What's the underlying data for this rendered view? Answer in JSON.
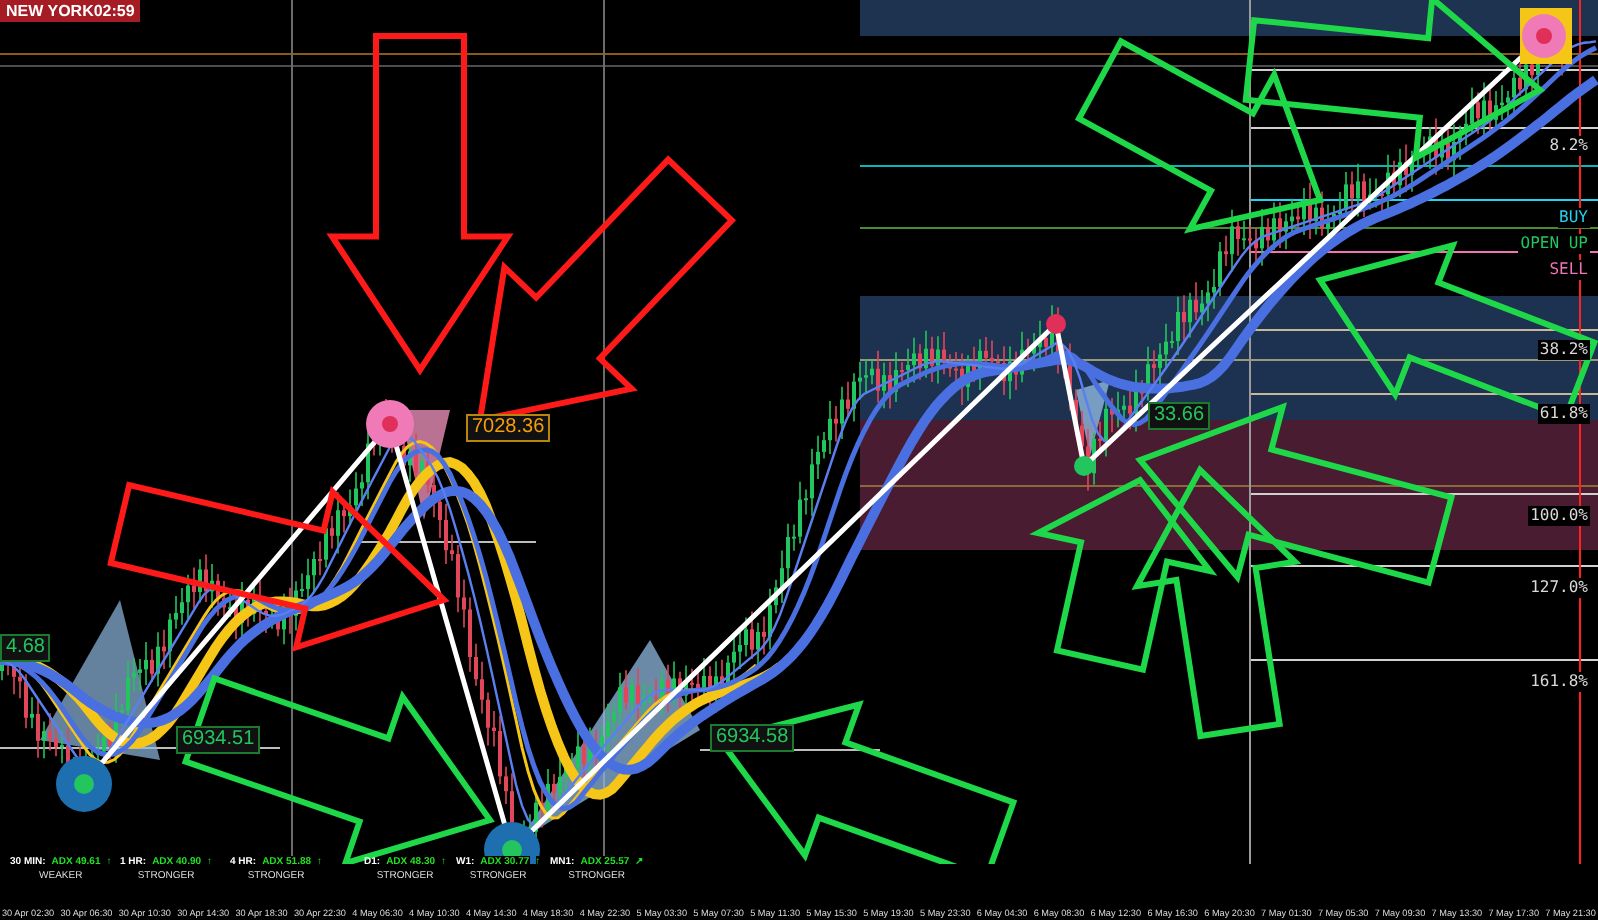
{
  "clock": {
    "label": "NEW YORK02:59"
  },
  "levels": [
    {
      "kind": "fib",
      "label": "8.2%"
    },
    {
      "kind": "buy",
      "label": "BUY"
    },
    {
      "kind": "open",
      "label": "OPEN UP"
    },
    {
      "kind": "sell",
      "label": "SELL"
    },
    {
      "kind": "fib",
      "label": "38.2%"
    },
    {
      "kind": "fib",
      "label": "61.8%"
    },
    {
      "kind": "fib",
      "label": "100.0%"
    },
    {
      "kind": "fib",
      "label": "127.0%"
    },
    {
      "kind": "fib",
      "label": "161.8%"
    }
  ],
  "price_labels": [
    {
      "kind": "low",
      "label": "4.68"
    },
    {
      "kind": "high",
      "label": "7028.36"
    },
    {
      "kind": "low",
      "label": "6934.51"
    },
    {
      "kind": "low",
      "label": "6934.58"
    },
    {
      "kind": "low",
      "label": "33.66"
    }
  ],
  "adx_panels": [
    {
      "timeframe": "30 MIN:",
      "adx": "ADX 49.61",
      "arrow": "↑",
      "strength": "WEAKER"
    },
    {
      "timeframe": "1 HR:",
      "adx": "ADX 40.90",
      "arrow": "↑",
      "strength": "STRONGER"
    },
    {
      "timeframe": "4 HR:",
      "adx": "ADX 51.88",
      "arrow": "↑",
      "strength": "STRONGER"
    },
    {
      "timeframe": "D1:",
      "adx": "ADX 48.30",
      "arrow": "↑",
      "strength": "STRONGER"
    },
    {
      "timeframe": "W1:",
      "adx": "ADX 30.77",
      "arrow": "↑",
      "strength": "STRONGER"
    },
    {
      "timeframe": "MN1:",
      "adx": "ADX 25.57",
      "arrow": "↗",
      "strength": "STRONGER"
    }
  ],
  "time_axis": [
    "30 Apr 02:30",
    "30 Apr 06:30",
    "30 Apr 10:30",
    "30 Apr 14:30",
    "30 Apr 18:30",
    "30 Apr 22:30",
    "4 May 06:30",
    "4 May 10:30",
    "4 May 14:30",
    "4 May 18:30",
    "4 May 22:30",
    "5 May 03:30",
    "5 May 07:30",
    "5 May 11:30",
    "5 May 15:30",
    "5 May 19:30",
    "5 May 23:30",
    "6 May 04:30",
    "6 May 08:30",
    "6 May 12:30",
    "6 May 16:30",
    "6 May 20:30",
    "7 May 01:30",
    "7 May 05:30",
    "7 May 09:30",
    "7 May 13:30",
    "7 May 17:30",
    "7 May 21:30"
  ]
}
